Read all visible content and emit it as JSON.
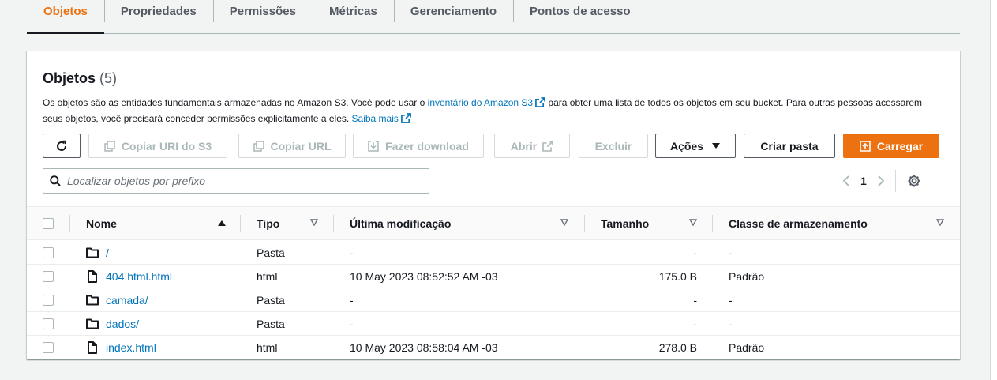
{
  "tabs": [
    {
      "label": "Objetos",
      "active": true
    },
    {
      "label": "Propriedades"
    },
    {
      "label": "Permissões"
    },
    {
      "label": "Métricas"
    },
    {
      "label": "Gerenciamento"
    },
    {
      "label": "Pontos de acesso"
    }
  ],
  "panel": {
    "title": "Objetos",
    "count": "(5)",
    "desc_part1": "Os objetos são as entidades fundamentais armazenadas no Amazon S3. Você pode usar o ",
    "desc_link1": "inventário do Amazon S3",
    "desc_part2": " para obter uma lista de todos os objetos em seu bucket. Para outras pessoas acessarem seus objetos, você precisará conceder permissões explicitamente a eles. ",
    "desc_link2": "Saiba mais"
  },
  "toolbar": {
    "copy_uri": "Copiar URI do S3",
    "copy_url": "Copiar URL",
    "download": "Fazer download",
    "open": "Abrir",
    "delete": "Excluir",
    "actions": "Ações",
    "create_folder": "Criar pasta",
    "upload": "Carregar"
  },
  "search": {
    "placeholder": "Localizar objetos por prefixo"
  },
  "pagination": {
    "page": "1"
  },
  "table": {
    "headers": {
      "name": "Nome",
      "type": "Tipo",
      "modified": "Última modificação",
      "size": "Tamanho",
      "storage": "Classe de armazenamento"
    },
    "rows": [
      {
        "name": "/",
        "icon": "folder-icon",
        "type": "Pasta",
        "modified": "-",
        "size": "-",
        "storage": "-"
      },
      {
        "name": "404.html.html",
        "icon": "file-icon",
        "type": "html",
        "modified": "10 May 2023 08:52:52 AM -03",
        "size": "175.0 B",
        "storage": "Padrão"
      },
      {
        "name": "camada/",
        "icon": "folder-icon",
        "type": "Pasta",
        "modified": "-",
        "size": "-",
        "storage": "-"
      },
      {
        "name": "dados/",
        "icon": "folder-icon",
        "type": "Pasta",
        "modified": "-",
        "size": "-",
        "storage": "-"
      },
      {
        "name": "index.html",
        "icon": "file-icon",
        "type": "html",
        "modified": "10 May 2023 08:58:04 AM -03",
        "size": "278.0 B",
        "storage": "Padrão"
      }
    ]
  },
  "colors": {
    "accent": "#ec7211",
    "link": "#0073bb",
    "text": "#16191f",
    "muted": "#545b64",
    "disabled": "#aab7b8"
  }
}
